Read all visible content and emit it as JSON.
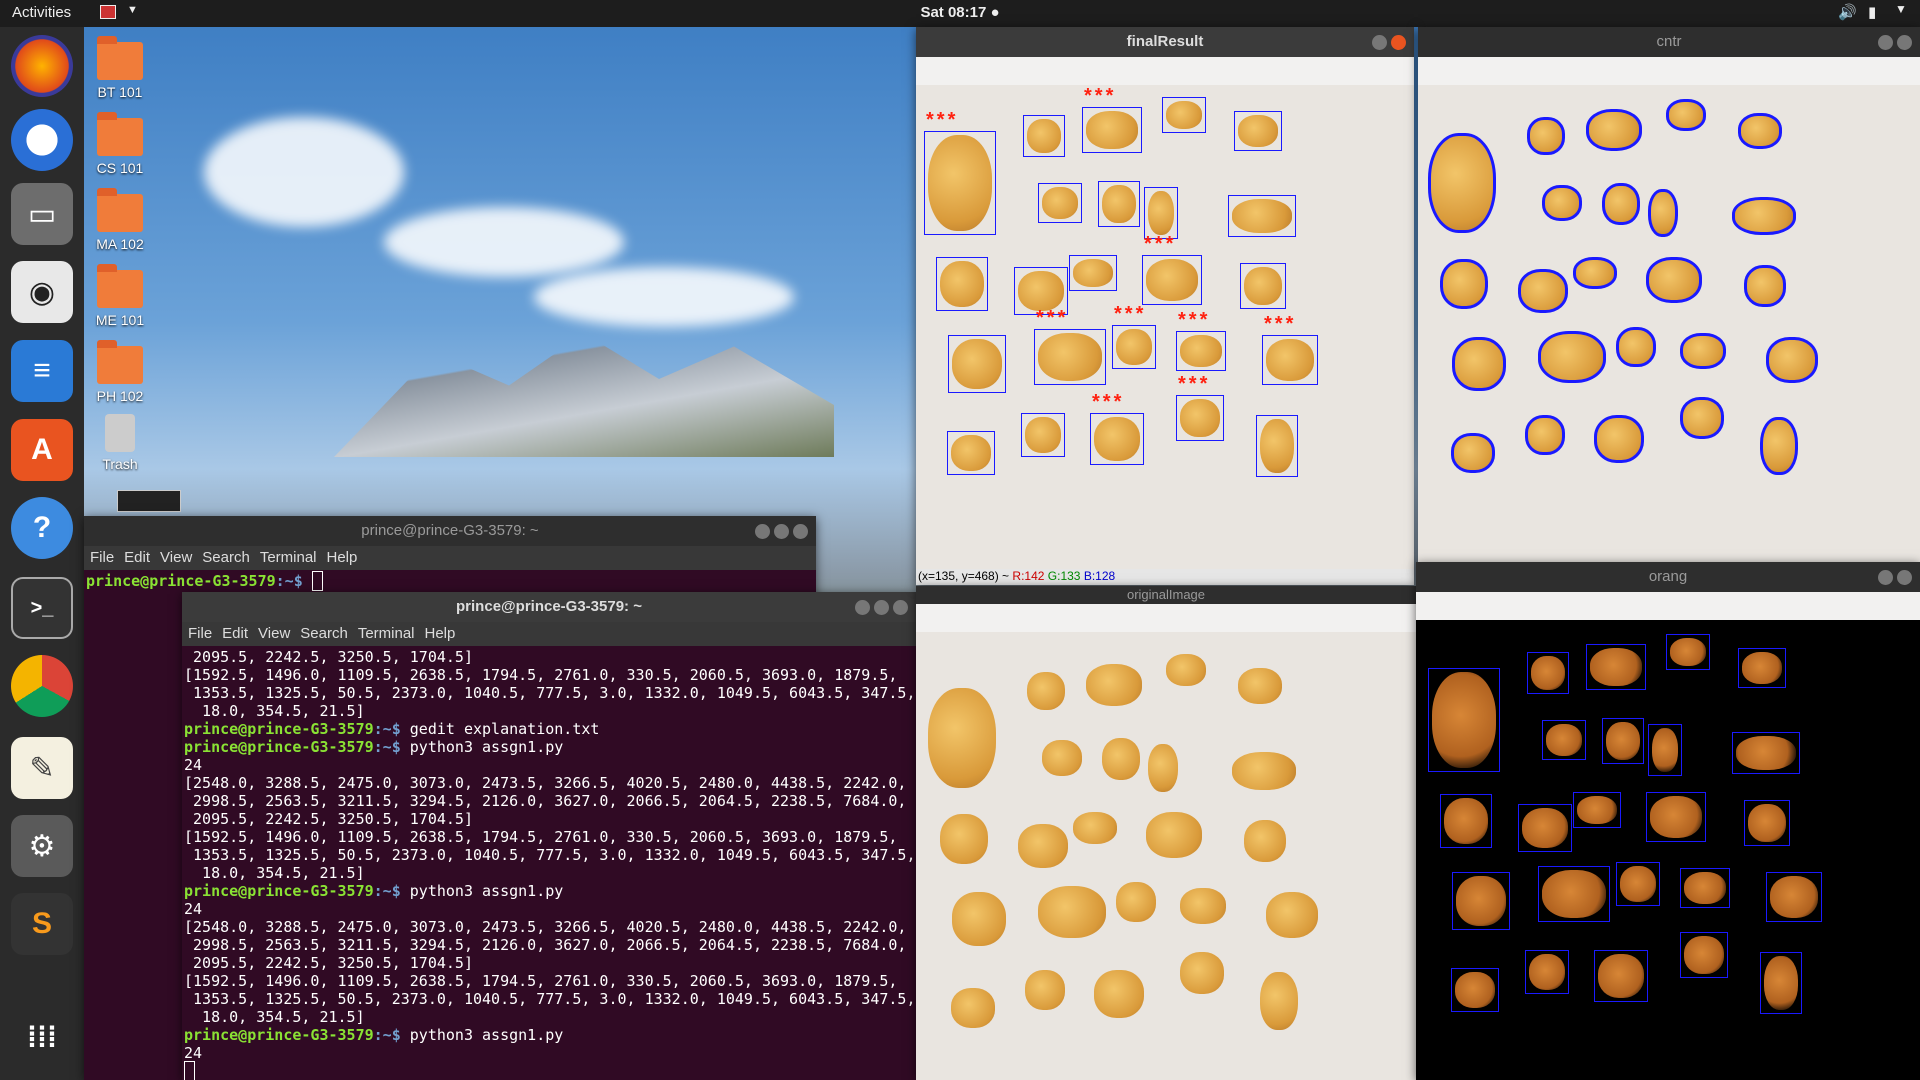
{
  "topbar": {
    "activities": "Activities",
    "clock": "Sat 08:17 ●"
  },
  "desktop": {
    "icons": [
      {
        "label": "BT 101"
      },
      {
        "label": "CS 101"
      },
      {
        "label": "MA 102"
      },
      {
        "label": "ME 101"
      },
      {
        "label": "PH 102"
      },
      {
        "label": "Trash"
      }
    ]
  },
  "dock": {
    "apps": [
      "firefox-icon",
      "thunderbird-icon",
      "files-icon",
      "rhythmbox-icon",
      "writer-icon",
      "software-icon",
      "help-icon",
      "terminal-icon",
      "chrome-icon",
      "gedit-icon",
      "settings-icon",
      "sublime-icon",
      "apps-grid-icon"
    ]
  },
  "term1": {
    "title": "prince@prince-G3-3579: ~",
    "menu": [
      "File",
      "Edit",
      "View",
      "Search",
      "Terminal",
      "Help"
    ],
    "prompt_user": "prince@prince-G3-3579",
    "prompt_path": ":~$ "
  },
  "term2": {
    "title": "prince@prince-G3-3579: ~",
    "menu": [
      "File",
      "Edit",
      "View",
      "Search",
      "Terminal",
      "Help"
    ],
    "lines": [
      {
        "t": "out",
        "text": " 2095.5, 2242.5, 3250.5, 1704.5]"
      },
      {
        "t": "out",
        "text": "[1592.5, 1496.0, 1109.5, 2638.5, 1794.5, 2761.0, 330.5, 2060.5, 3693.0, 1879.5,"
      },
      {
        "t": "out",
        "text": " 1353.5, 1325.5, 50.5, 2373.0, 1040.5, 777.5, 3.0, 1332.0, 1049.5, 6043.5, 347.5,"
      },
      {
        "t": "out",
        "text": "  18.0, 354.5, 21.5]"
      },
      {
        "t": "cmd",
        "text": "gedit explanation.txt"
      },
      {
        "t": "cmd",
        "text": "python3 assgn1.py"
      },
      {
        "t": "out",
        "text": "24"
      },
      {
        "t": "out",
        "text": "[2548.0, 3288.5, 2475.0, 3073.0, 2473.5, 3266.5, 4020.5, 2480.0, 4438.5, 2242.0,"
      },
      {
        "t": "out",
        "text": " 2998.5, 2563.5, 3211.5, 3294.5, 2126.0, 3627.0, 2066.5, 2064.5, 2238.5, 7684.0,"
      },
      {
        "t": "out",
        "text": " 2095.5, 2242.5, 3250.5, 1704.5]"
      },
      {
        "t": "out",
        "text": "[1592.5, 1496.0, 1109.5, 2638.5, 1794.5, 2761.0, 330.5, 2060.5, 3693.0, 1879.5,"
      },
      {
        "t": "out",
        "text": " 1353.5, 1325.5, 50.5, 2373.0, 1040.5, 777.5, 3.0, 1332.0, 1049.5, 6043.5, 347.5,"
      },
      {
        "t": "out",
        "text": "  18.0, 354.5, 21.5]"
      },
      {
        "t": "cmd",
        "text": "python3 assgn1.py"
      },
      {
        "t": "out",
        "text": "24"
      },
      {
        "t": "out",
        "text": "[2548.0, 3288.5, 2475.0, 3073.0, 2473.5, 3266.5, 4020.5, 2480.0, 4438.5, 2242.0,"
      },
      {
        "t": "out",
        "text": " 2998.5, 2563.5, 3211.5, 3294.5, 2126.0, 3627.0, 2066.5, 2064.5, 2238.5, 7684.0,"
      },
      {
        "t": "out",
        "text": " 2095.5, 2242.5, 3250.5, 1704.5]"
      },
      {
        "t": "out",
        "text": "[1592.5, 1496.0, 1109.5, 2638.5, 1794.5, 2761.0, 330.5, 2060.5, 3693.0, 1879.5,"
      },
      {
        "t": "out",
        "text": " 1353.5, 1325.5, 50.5, 2373.0, 1040.5, 777.5, 3.0, 1332.0, 1049.5, 6043.5, 347.5,"
      },
      {
        "t": "out",
        "text": "  18.0, 354.5, 21.5]"
      },
      {
        "t": "cmd",
        "text": "python3 assgn1.py"
      },
      {
        "t": "out",
        "text": "24"
      }
    ]
  },
  "win_final": {
    "title": "finalResult",
    "status_xy": "(x=135, y=468) ~ ",
    "status_r": "R:142",
    "status_g": "G:133",
    "status_b": "B:128",
    "stars": "***"
  },
  "win_cntr": {
    "title": "cntr"
  },
  "win_orig": {
    "title": "originalImage"
  },
  "win_orang": {
    "title": "orang"
  },
  "colors": {
    "accent": "#e95420",
    "terminal_bg": "#300a24",
    "box": "#1a1aff",
    "stars": "#ff2211"
  }
}
